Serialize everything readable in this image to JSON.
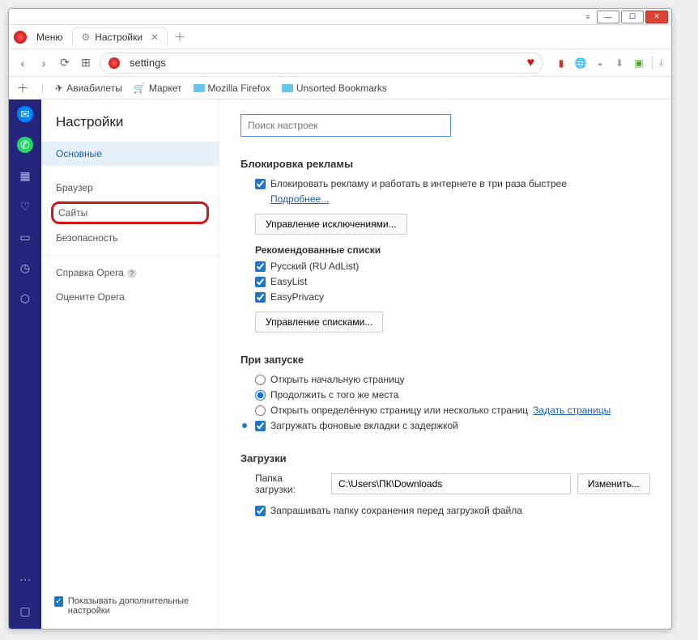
{
  "menu": "Меню",
  "tab": {
    "title": "Настройки"
  },
  "address": {
    "value": "settings"
  },
  "bookmarks": [
    "Авиабилеты",
    "Маркет",
    "Mozilla Firefox",
    "Unsorted Bookmarks"
  ],
  "nav": {
    "title": "Настройки",
    "items": [
      "Основные",
      "Браузер",
      "Сайты",
      "Безопасность",
      "Справка Opera",
      "Оцените Opera"
    ],
    "footer": "Показывать дополнительные настройки"
  },
  "search_placeholder": "Поиск настроек",
  "adblock": {
    "title": "Блокировка рекламы",
    "label": "Блокировать рекламу и работать в интернете в три раза быстрее",
    "more": "Подробнее...",
    "btn1": "Управление исключениями...",
    "sub": "Рекомендованные списки",
    "lists": [
      "Русский (RU AdList)",
      "EasyList",
      "EasyPrivacy"
    ],
    "btn2": "Управление списками..."
  },
  "startup": {
    "title": "При запуске",
    "opt1": "Открыть начальную страницу",
    "opt2": "Продолжить с того же места",
    "opt3": "Открыть определённую страницу или несколько страниц",
    "opt3_link": "Задать страницы",
    "opt4": "Загружать фоновые вкладки с задержкой"
  },
  "downloads": {
    "title": "Загрузки",
    "folder_label": "Папка загрузки:",
    "folder_value": "C:\\Users\\ПК\\Downloads",
    "change": "Изменить...",
    "ask": "Запрашивать папку сохранения перед загрузкой файла"
  }
}
